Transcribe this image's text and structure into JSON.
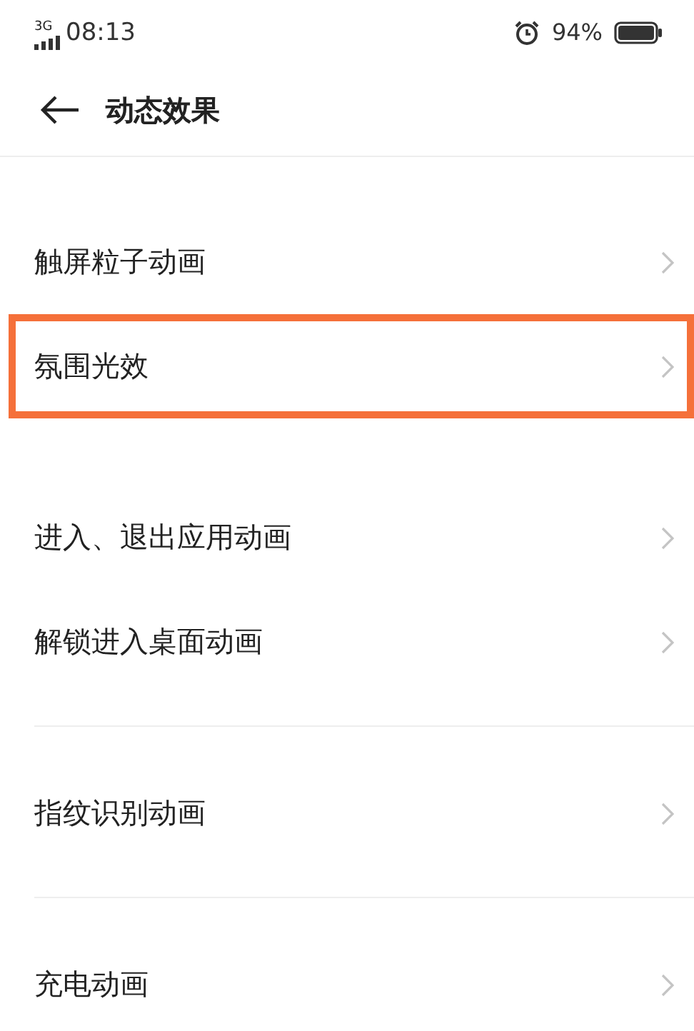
{
  "status_bar": {
    "network": "3G",
    "time": "08:13",
    "battery": "94%",
    "alarm": true
  },
  "header": {
    "title": "动态效果"
  },
  "groups": [
    {
      "divider": false,
      "items": [
        {
          "label": "触屏粒子动画",
          "highlighted": false
        },
        {
          "label": "氛围光效",
          "highlighted": true
        }
      ]
    },
    {
      "divider": false,
      "items": [
        {
          "label": "进入、退出应用动画",
          "highlighted": false
        },
        {
          "label": "解锁进入桌面动画",
          "highlighted": false
        }
      ]
    },
    {
      "divider": true,
      "items": [
        {
          "label": "指纹识别动画",
          "highlighted": false
        }
      ]
    },
    {
      "divider": true,
      "items": [
        {
          "label": "充电动画",
          "highlighted": false
        }
      ]
    }
  ]
}
